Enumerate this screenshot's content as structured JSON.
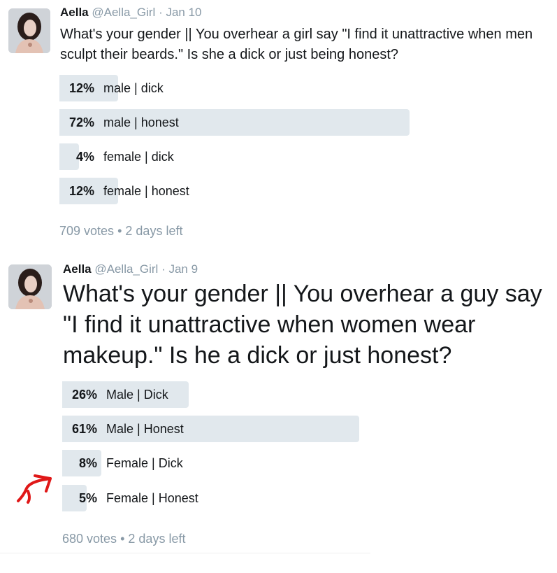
{
  "tweets": [
    {
      "name": "Aella",
      "handle": "@Aella_Girl",
      "dot": "·",
      "date": "Jan 10",
      "text": "What's your gender || You overhear a girl say \"I find it unattractive when men sculpt their beards.\" Is she a dick or just being honest?",
      "options": [
        {
          "pct": "12%",
          "label": "male | dick",
          "fraction": 0.12
        },
        {
          "pct": "72%",
          "label": "male | honest",
          "fraction": 0.72
        },
        {
          "pct": "4%",
          "label": "female | dick",
          "fraction": 0.04
        },
        {
          "pct": "12%",
          "label": "female | honest",
          "fraction": 0.12
        }
      ],
      "votes": "709 votes",
      "bullet": "•",
      "time_left": "2 days left"
    },
    {
      "name": "Aella",
      "handle": "@Aella_Girl",
      "dot": "·",
      "date": "Jan 9",
      "text": "What's your gender || You overhear a guy say \"I find it unattractive when women wear makeup.\" Is he a dick or just honest?",
      "options": [
        {
          "pct": "26%",
          "label": "Male | Dick",
          "fraction": 0.26
        },
        {
          "pct": "61%",
          "label": "Male | Honest",
          "fraction": 0.61
        },
        {
          "pct": "8%",
          "label": "Female | Dick",
          "fraction": 0.08
        },
        {
          "pct": "5%",
          "label": "Female | Honest",
          "fraction": 0.05
        }
      ],
      "votes": "680 votes",
      "bullet": "•",
      "time_left": "2 days left"
    }
  ],
  "colors": {
    "bar": "#e1e8ed",
    "muted": "#8899a6",
    "text": "#14171a",
    "annotation": "#e01818"
  },
  "annotation": {
    "icon": "red-arrow-icon"
  }
}
